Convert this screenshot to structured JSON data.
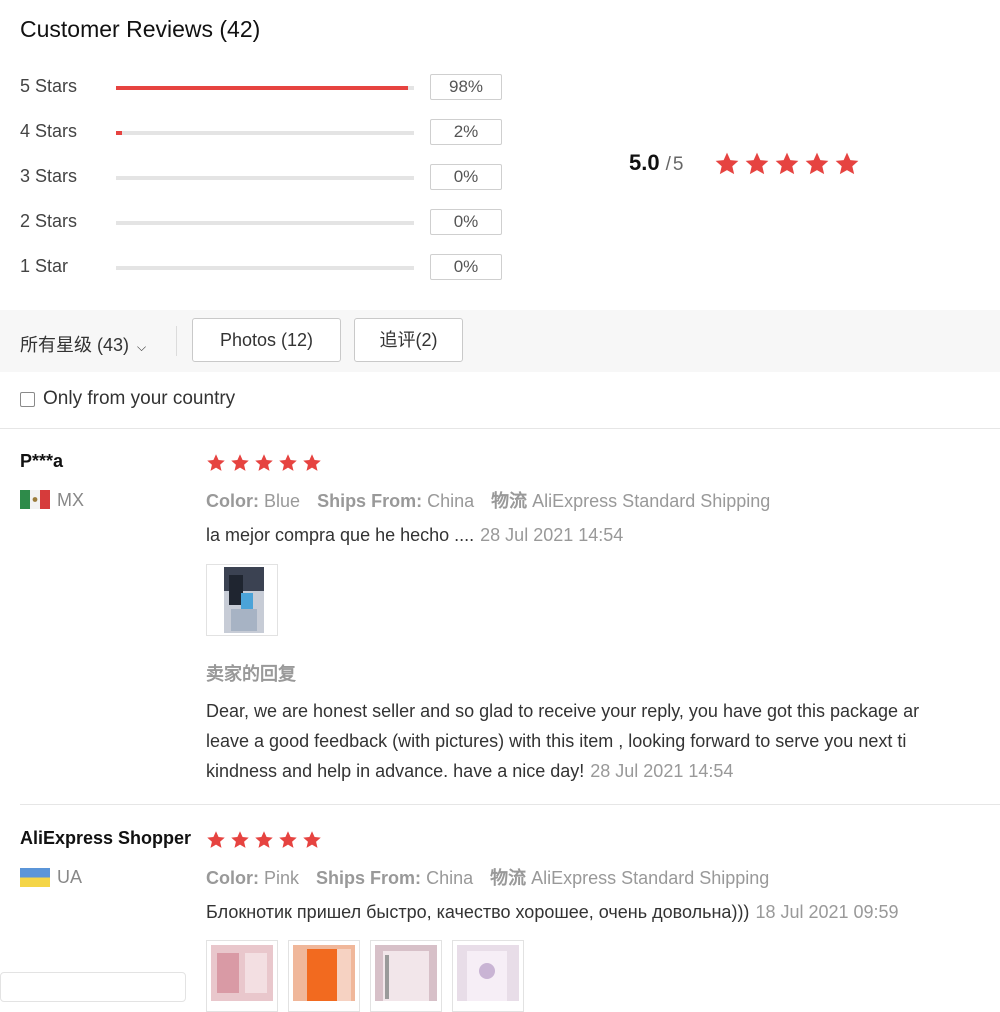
{
  "header": {
    "title": "Customer Reviews (42)"
  },
  "histogram": [
    {
      "label": "5 Stars",
      "percent": "98%",
      "fill": 0.98
    },
    {
      "label": "4 Stars",
      "percent": "2%",
      "fill": 0.02
    },
    {
      "label": "3 Stars",
      "percent": "0%",
      "fill": 0
    },
    {
      "label": "2 Stars",
      "percent": "0%",
      "fill": 0
    },
    {
      "label": "1 Star",
      "percent": "0%",
      "fill": 0
    }
  ],
  "summary": {
    "average": "5.0",
    "separator": "/",
    "max": "5",
    "stars": 5
  },
  "filters": {
    "all_label": "所有星级 (43)",
    "photos_label": "Photos (12)",
    "followup_label": "追评(2)"
  },
  "country_filter": {
    "label": "Only from your country",
    "checked": false
  },
  "reviews": [
    {
      "user": "P***a",
      "country": "MX",
      "stars": 5,
      "color_key": "Color:",
      "color_val": "Blue",
      "ships_key": "Ships From:",
      "ships_val": "China",
      "logistics_key": "物流",
      "logistics_val": "AliExpress Standard Shipping",
      "text": "la mejor compra que he hecho ....",
      "date": "28 Jul 2021 14:54",
      "seller_reply_heading": "卖家的回复",
      "seller_reply_lines": [
        "Dear, we are honest seller and so glad to receive your reply, you have got this package ar",
        "leave a good feedback (with pictures) with this item , looking forward to serve you next ti",
        "kindness and help in advance. have a nice day!"
      ],
      "seller_reply_date": "28 Jul 2021 14:54"
    },
    {
      "user": "AliExpress Shopper",
      "country": "UA",
      "stars": 5,
      "color_key": "Color:",
      "color_val": "Pink",
      "ships_key": "Ships From:",
      "ships_val": "China",
      "logistics_key": "物流",
      "logistics_val": "AliExpress Standard Shipping",
      "text": "Блокнотик пришел быстро, качество хорошее, очень довольна)))",
      "date": "18 Jul 2021 09:59"
    }
  ],
  "colors": {
    "star": "#e64340",
    "bar": "#e64340",
    "track": "#e4e4e4"
  }
}
